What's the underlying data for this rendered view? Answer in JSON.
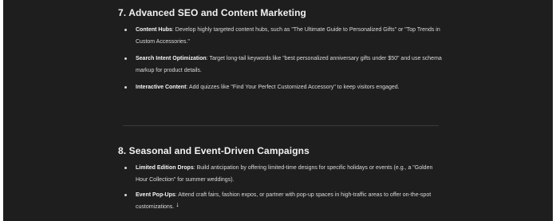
{
  "sections": [
    {
      "heading": "7. Advanced SEO and Content Marketing",
      "items": [
        {
          "term": "Content Hubs",
          "text": ": Develop highly targeted content hubs, such as \"The Ultimate Guide to Personalized Gifts\" or \"Top Trends in Custom Accessories.\""
        },
        {
          "term": "Search Intent Optimization",
          "text": ": Target long-tail keywords like \"best personalized anniversary gifts under $50\" and use schema markup for product details."
        },
        {
          "term": "Interactive Content",
          "text": ": Add quizzes like \"Find Your Perfect Customized Accessory\" to keep visitors engaged."
        }
      ]
    },
    {
      "heading": "8. Seasonal and Event-Driven Campaigns",
      "items": [
        {
          "term": "Limited Edition Drops",
          "text": ": Build anticipation by offering limited-time designs for specific holidays or events (e.g., a \"Golden Hour Collection\" for summer weddings)."
        },
        {
          "term": "Event Pop-Ups",
          "text": ": Attend craft fairs, fashion expos, or partner with pop-up spaces in high-traffic areas to offer on-the-spot customizations."
        }
      ]
    }
  ],
  "scroll_indicator_icon": "arrow-down-icon",
  "scroll_indicator_glyph": "↓",
  "colors": {
    "panel_background": "#1e1e1e",
    "heading_text": "#f2f2f2",
    "body_text": "#dcdcdc",
    "divider": "#3a3a3a"
  }
}
